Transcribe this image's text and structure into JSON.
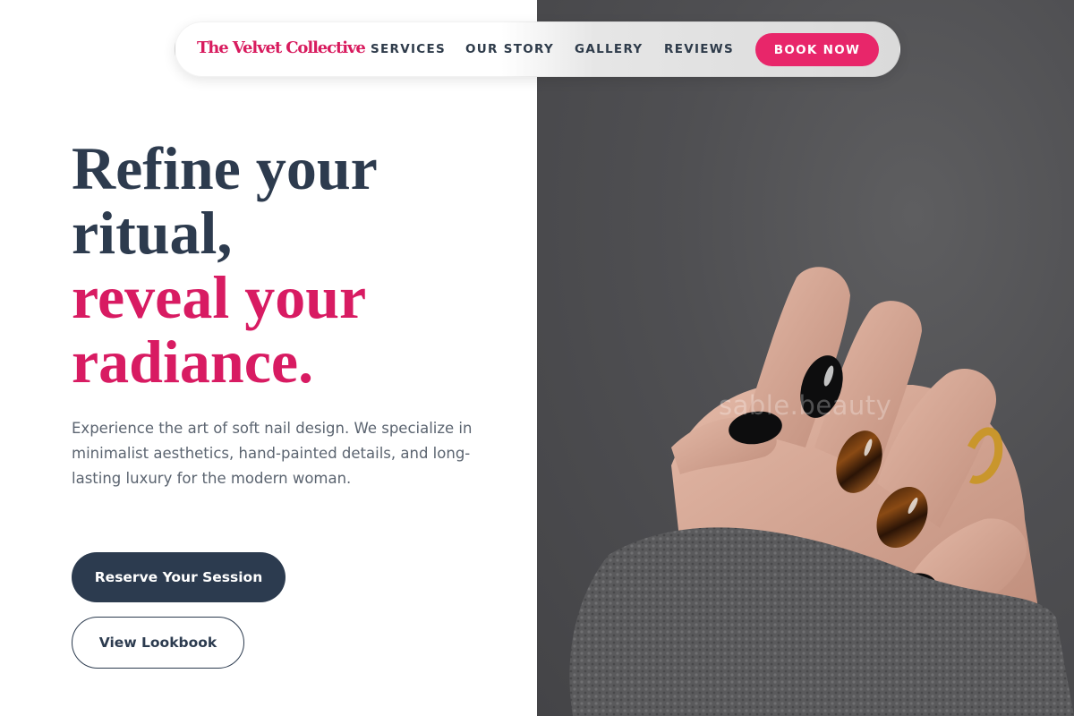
{
  "brand": {
    "name": "The Velvet Collective",
    "color": "#d81b5e"
  },
  "nav": {
    "links": [
      "SERVICES",
      "OUR STORY",
      "GALLERY",
      "REVIEWS"
    ],
    "cta": "BOOK NOW"
  },
  "hero": {
    "headline_line1": "Refine your",
    "headline_line2": "ritual,",
    "headline_accent_line1": "reveal your",
    "headline_accent_line2": "radiance.",
    "description": "Experience the art of soft nail design. We specialize in minimalist aesthetics, hand-painted details, and long-lasting luxury for the modern woman.",
    "primary_cta": "Reserve Your Session",
    "secondary_cta": "View Lookbook"
  },
  "photo": {
    "watermark": "sable.beauty"
  },
  "colors": {
    "accent": "#e8266a",
    "headline_dark": "#2d3b4e",
    "body_text": "#5b6470",
    "button_dark": "#2c3b4f"
  },
  "icons": []
}
